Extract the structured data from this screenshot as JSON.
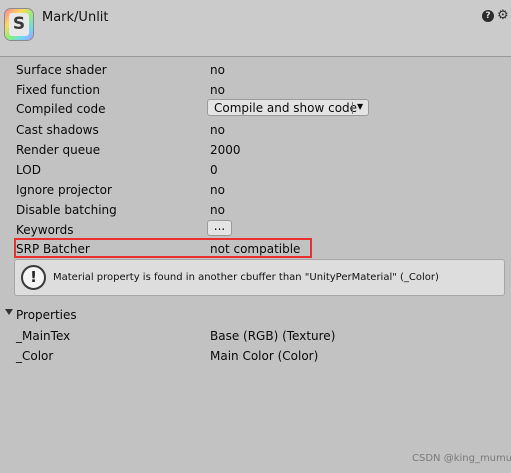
{
  "header": {
    "title": "Mark/Unlit",
    "icon_letter": "S",
    "help_glyph": "?",
    "gear_glyph": "⚙"
  },
  "properties": [
    {
      "label": "Surface shader",
      "value": "no"
    },
    {
      "label": "Fixed function",
      "value": "no"
    },
    {
      "label": "Compiled code",
      "value": "Compile and show code"
    },
    {
      "label": "Cast shadows",
      "value": "no"
    },
    {
      "label": "Render queue",
      "value": "2000"
    },
    {
      "label": "LOD",
      "value": "0"
    },
    {
      "label": "Ignore projector",
      "value": "no"
    },
    {
      "label": "Disable batching",
      "value": "no"
    },
    {
      "label": "Keywords",
      "value": "..."
    },
    {
      "label": "SRP Batcher",
      "value": "not compatible"
    }
  ],
  "compiled_code_arrow": "▼",
  "warning": {
    "icon_glyph": "!",
    "text": "Material property is found in another cbuffer than \"UnityPerMaterial\" (_Color)"
  },
  "properties_section": {
    "title": "Properties",
    "items": [
      {
        "name": "_MainTex",
        "value": "Base (RGB) (Texture)"
      },
      {
        "name": "_Color",
        "value": "Main Color (Color)"
      }
    ]
  },
  "watermark": "CSDN @king_mumu",
  "colors": {
    "background": "#c2c2c2",
    "highlight": "#e8312c"
  }
}
